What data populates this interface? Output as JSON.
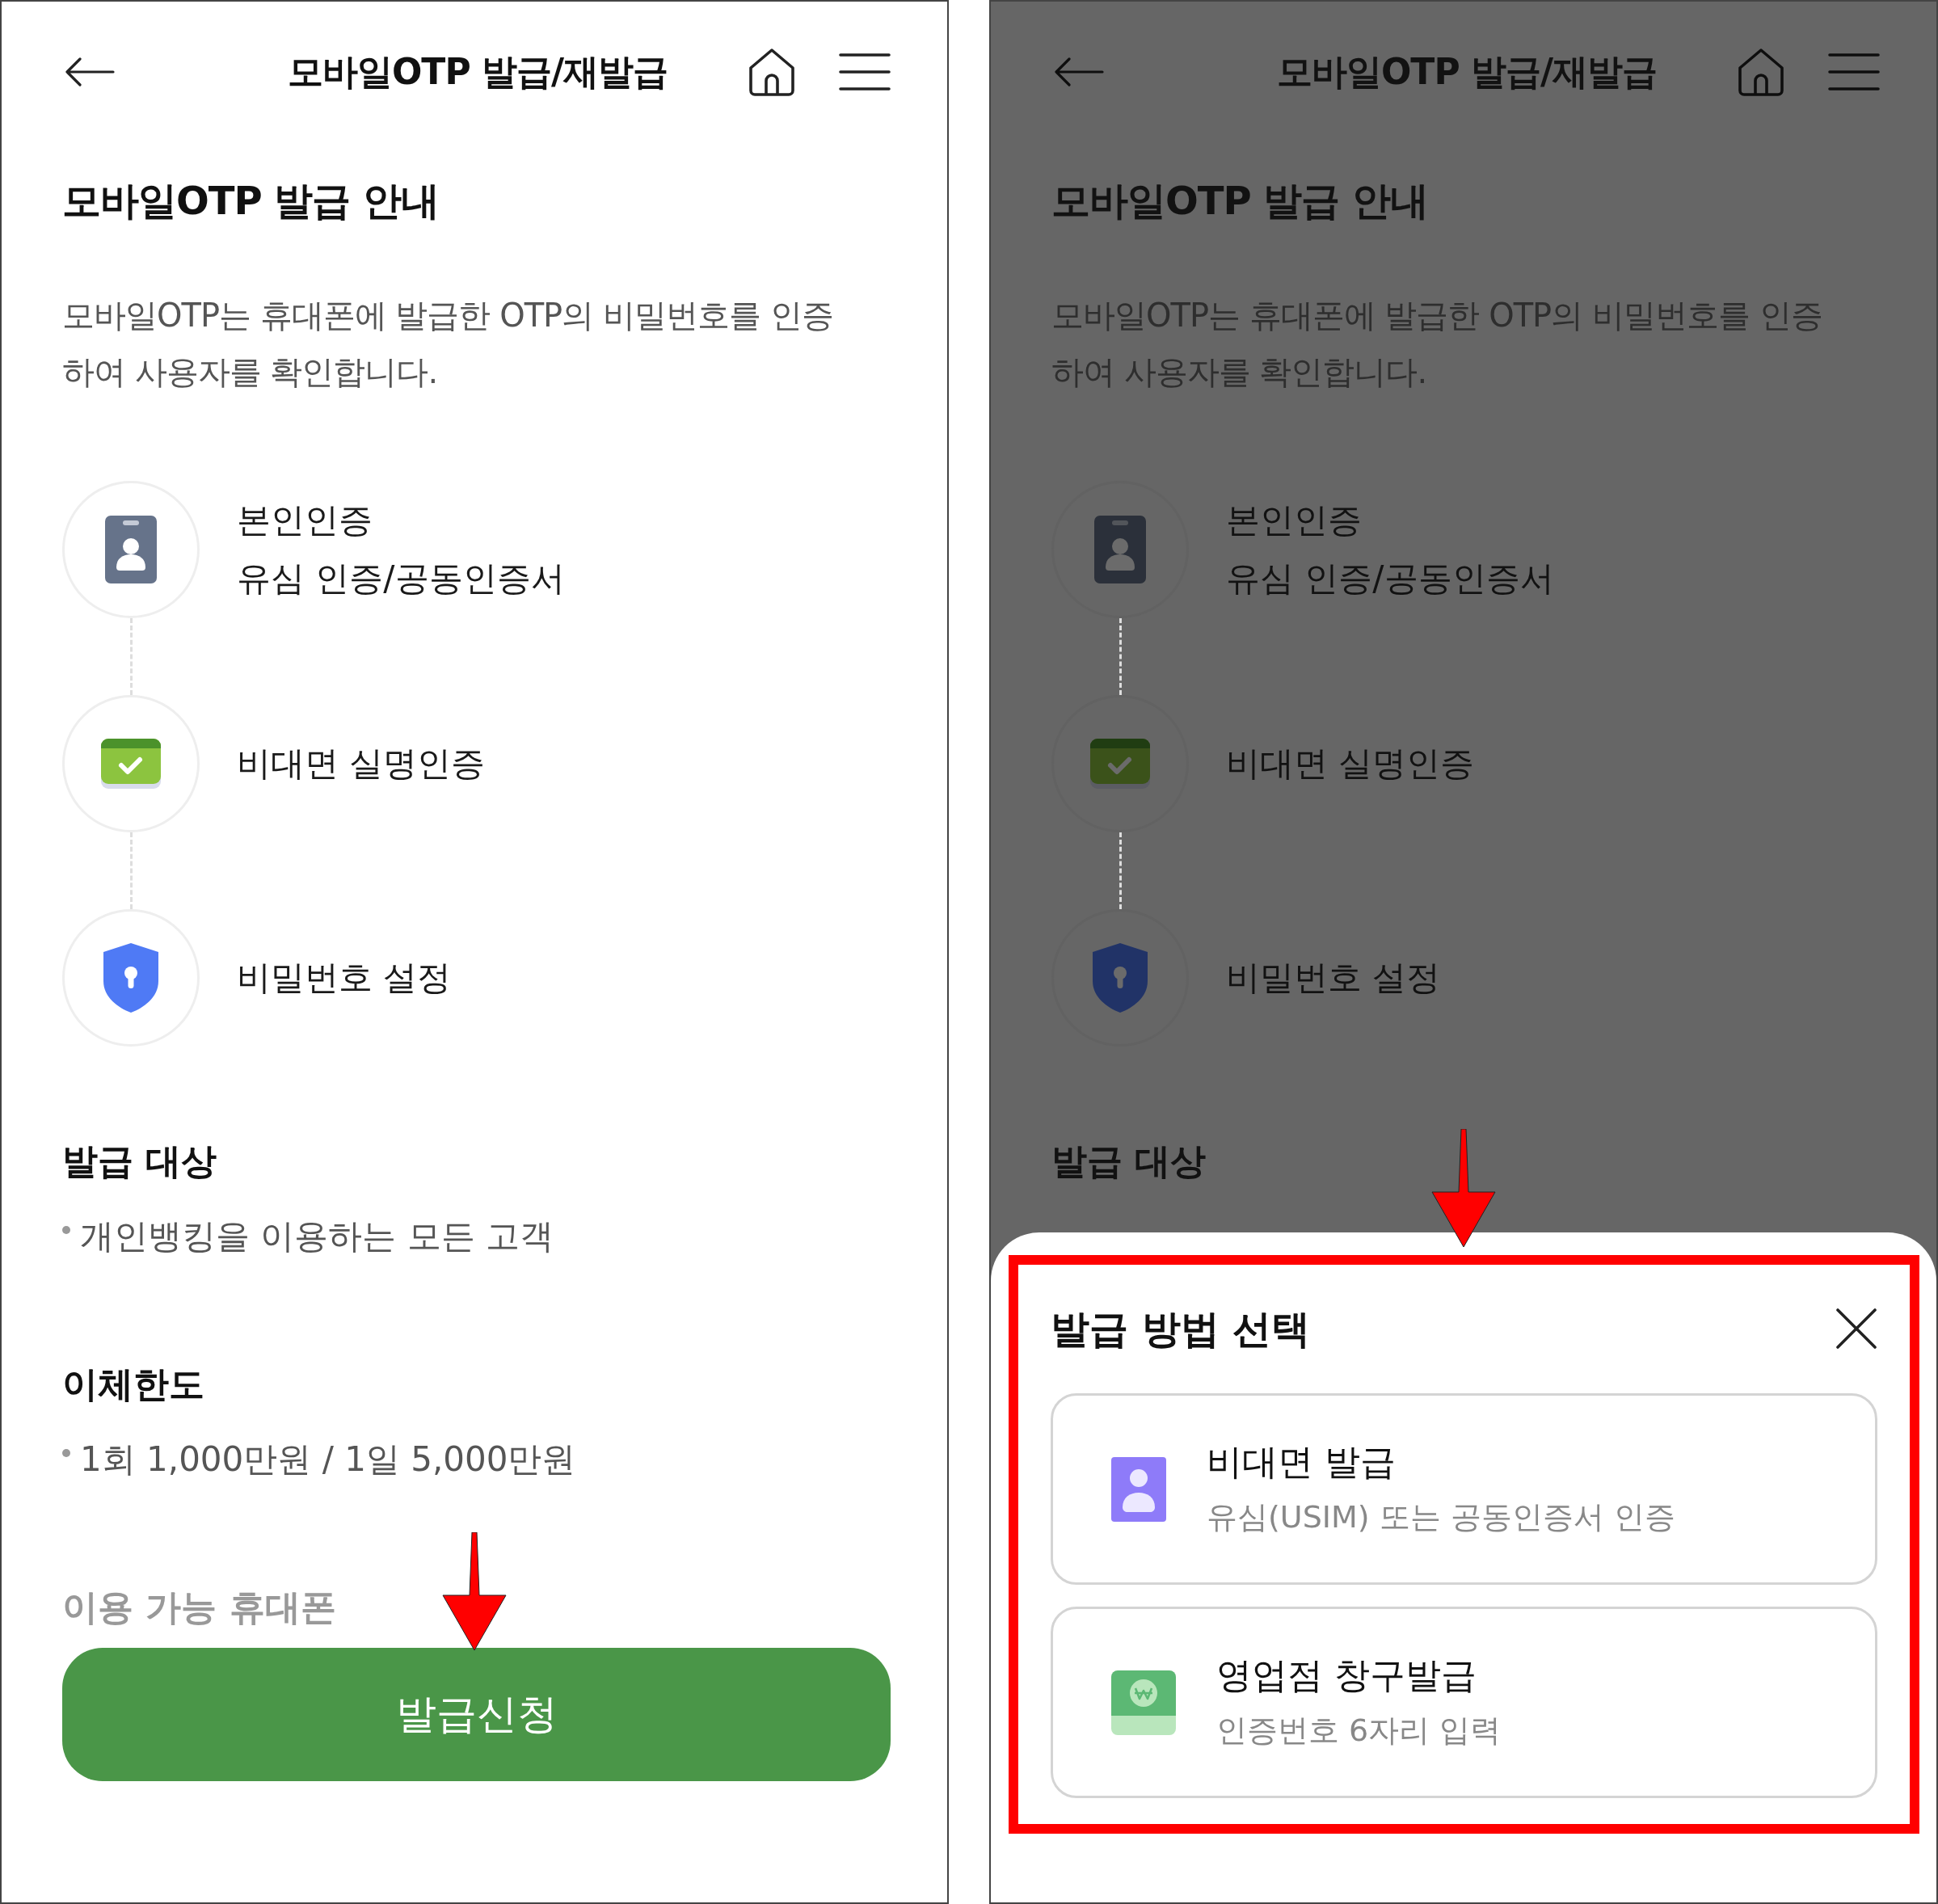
{
  "screens": [
    {
      "dimmed": false,
      "header": {
        "title": "모바일OTP 발급/재발급"
      },
      "heading": "모바일OTP 발급 안내",
      "description": "모바일OTP는 휴대폰에 발급한 OTP의 비밀번호를 인증하여 사용자를 확인합니다.",
      "steps": [
        {
          "kind": "id-card",
          "lines": [
            "본인인증",
            "유심 인증/공동인증서"
          ]
        },
        {
          "kind": "check-card",
          "lines": [
            "비대면 실명인증"
          ]
        },
        {
          "kind": "shield",
          "lines": [
            "비밀번호 설정"
          ]
        }
      ],
      "sections": [
        {
          "title": "발급 대상",
          "faded": false,
          "items": [
            "개인뱅킹을 이용하는 모든 고객"
          ]
        },
        {
          "title": "이체한도",
          "faded": false,
          "items": [
            "1회 1,000만원 / 1일 5,000만원"
          ]
        },
        {
          "title": "이용 가능 휴대폰",
          "faded": true
        }
      ],
      "button": "발급신청",
      "pointer": {
        "kind": "arrow"
      }
    },
    {
      "dimmed": true,
      "header": {
        "title": "모바일OTP 발급/재발급"
      },
      "heading": "모바일OTP 발급 안내",
      "description": "모바일OTP는 휴대폰에 발급한 OTP의 비밀번호를 인증하여 사용자를 확인합니다.",
      "steps": [
        {
          "kind": "id-card",
          "lines": [
            "본인인증",
            "유심 인증/공동인증서"
          ]
        },
        {
          "kind": "check-card",
          "lines": [
            "비대면 실명인증"
          ]
        },
        {
          "kind": "shield",
          "lines": [
            "비밀번호 설정"
          ]
        }
      ],
      "sections": [
        {
          "title": "발급 대상",
          "faded": false
        }
      ],
      "sheet": {
        "title": "발급 방법 선택",
        "highlighted": true,
        "options": [
          {
            "kind": "person",
            "title": "비대면 발급",
            "subtitle": "유심(USIM) 또는 공동인증서 인증"
          },
          {
            "kind": "cash",
            "title": "영업점 창구발급",
            "subtitle": "인증번호 6자리 입력"
          }
        ]
      },
      "pointer": {
        "kind": "arrow"
      }
    }
  ]
}
